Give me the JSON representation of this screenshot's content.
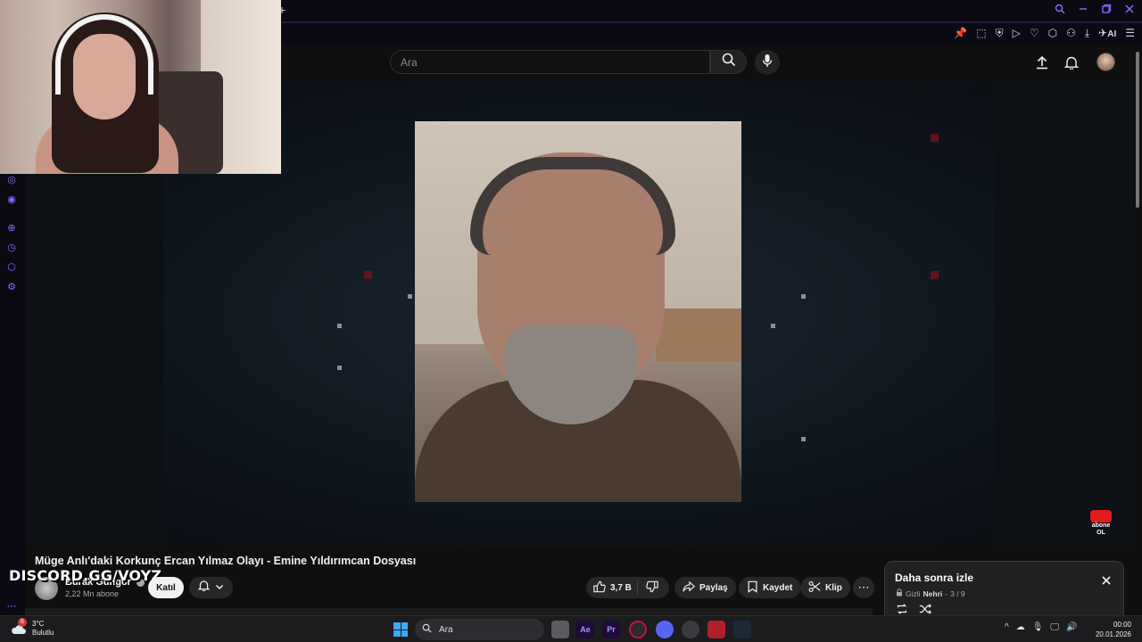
{
  "browser": {
    "new_tab_glyph": "+",
    "accent_color": "#8b6cff",
    "toolbar_ai_label": "AI"
  },
  "header": {
    "search_placeholder": "Ara",
    "search_icon": "search-icon",
    "mic_icon": "mic-icon",
    "upload_icon": "upload-icon",
    "notifications_icon": "bell-icon"
  },
  "video": {
    "title": "Müge Anlı'daki Korkunç Ercan Yılmaz Olayı - Emine Yıldırımcan Dosyası",
    "overlay_text": "DISCORD.GG/VOYZ",
    "subscribe_badge_line1": "abone",
    "subscribe_badge_line2": "OL"
  },
  "channel": {
    "name": "Burak Güngör",
    "subscribers": "2,22 Mn abone",
    "join_label": "Katıl"
  },
  "actions": {
    "like_count": "3,7 B",
    "share_label": "Paylaş",
    "save_label": "Kaydet",
    "clip_label": "Klip",
    "more_glyph": "⋯"
  },
  "watch_later": {
    "title": "Daha sonra izle",
    "privacy": "Gizli",
    "owner": "Nehri",
    "position": "3 / 9"
  },
  "taskbar": {
    "weather_temp": "3°C",
    "weather_desc": "Bulutlu",
    "weather_badge": "6",
    "search_label": "Ara",
    "ae_label": "Ae",
    "pr_label": "Pr",
    "time": "00:00",
    "date": "20.01.2026"
  },
  "colors": {
    "youtube_red": "#e21c1c",
    "pill_bg": "#272727",
    "windows_blue": "#3fa9f5"
  }
}
